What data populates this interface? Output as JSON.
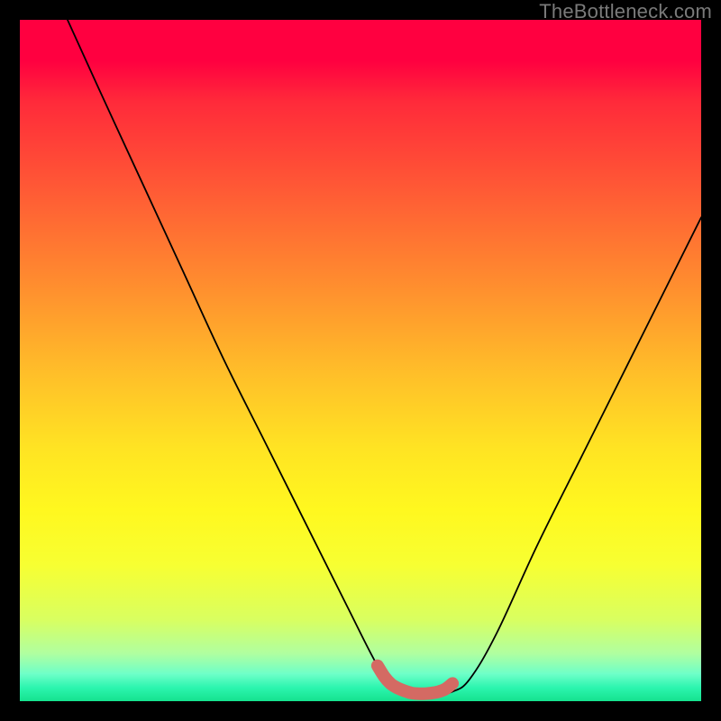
{
  "watermark": "TheBottleneck.com",
  "chart_data": {
    "type": "line",
    "title": "",
    "xlabel": "",
    "ylabel": "",
    "xlim": [
      0,
      100
    ],
    "ylim": [
      0,
      100
    ],
    "grid": false,
    "series": [
      {
        "name": "bottleneck-curve",
        "x": [
          7,
          12,
          18,
          24,
          30,
          36,
          42,
          48,
          52.5,
          55,
          58,
          61,
          63.5,
          66,
          70,
          76,
          83,
          90,
          97,
          100
        ],
        "y": [
          100,
          89,
          76,
          63,
          50,
          38,
          26,
          14,
          5.2,
          2.0,
          0.9,
          0.9,
          1.4,
          3.2,
          10,
          23,
          37,
          51,
          65,
          71
        ]
      },
      {
        "name": "optimal-marker",
        "x": [
          52.5,
          53.5,
          54.5,
          55.5,
          56.5,
          57.5,
          58.5,
          59.5,
          60.5,
          61.5,
          62.5,
          63.5
        ],
        "y": [
          5.2,
          3.6,
          2.5,
          1.9,
          1.5,
          1.2,
          1.1,
          1.1,
          1.2,
          1.4,
          1.8,
          2.6
        ]
      }
    ],
    "colors": {
      "curve": "#000000",
      "marker": "#d46a63",
      "gradient_top": "#ff0040",
      "gradient_bottom": "#15e28e"
    },
    "marker_style": "thick-rounded"
  }
}
